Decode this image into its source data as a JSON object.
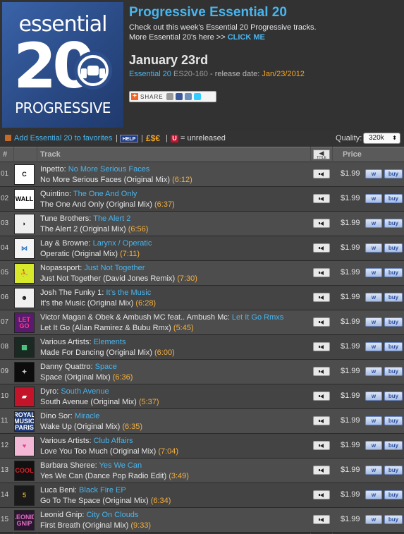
{
  "colors": {
    "accent_blue": "#49b5ee",
    "duration_orange": "#f5b041",
    "logo_blue": "#2d4f8c",
    "unreleased_red": "#c8102e"
  },
  "logo": {
    "top": "essential",
    "middle": "20",
    "bottom": "PROGRESSIVE"
  },
  "header": {
    "title": "Progressive Essential 20",
    "desc1": "Check out this week's Essential 20 Progressive tracks.",
    "desc2_prefix": "More Essential 20's here >>",
    "desc2_link": "CLICK ME",
    "date": "January 23rd",
    "label": "Essential 20",
    "catalog": "ES20-160",
    "release_prefix": " - release date: ",
    "release_date": "Jan/23/2012",
    "share_label": "SHARE"
  },
  "toolbar": {
    "favorites": "Add Essential 20 to favorites",
    "sep": "|",
    "help": "HELP",
    "currency": "£$€",
    "unreleased_badge": "U",
    "unreleased_text": "= unreleased",
    "quality_label": "Quality:",
    "quality_value": "320k"
  },
  "table": {
    "col_num": "#",
    "col_track": "Track",
    "col_title_icon": "TITLE",
    "col_price": "Price",
    "w_label": "w",
    "buy_label": "buy",
    "rows": [
      {
        "num": "01",
        "artist": "Inpetto:",
        "title": "No More Serious Faces",
        "mix": "No More Serious Faces (Original Mix)",
        "dur": "(6:12)",
        "price": "$1.99",
        "art": "C",
        "art_bg": "#ffffff",
        "art_fg": "#111111"
      },
      {
        "num": "02",
        "artist": "Quintino:",
        "title": "The One And Only",
        "mix": "The One And Only (Original Mix)",
        "dur": "(6:37)",
        "price": "$1.99",
        "art": "WALL",
        "art_bg": "#ffffff",
        "art_fg": "#000000"
      },
      {
        "num": "03",
        "artist": "Tune Brothers:",
        "title": "The Alert 2",
        "mix": "The Alert 2 (Original Mix)",
        "dur": "(6:56)",
        "price": "$1.99",
        "art": "◗",
        "art_bg": "#eeeeee",
        "art_fg": "#111111"
      },
      {
        "num": "04",
        "artist": "Lay & Browne:",
        "title": "Larynx / Operatic",
        "mix": "Operatic (Original Mix)",
        "dur": "(7:11)",
        "price": "$1.99",
        "art": "⋈",
        "art_bg": "#f4f4f4",
        "art_fg": "#2a73c4"
      },
      {
        "num": "05",
        "artist": "Nopassport:",
        "title": "Just Not Together",
        "mix": "Just Not Together (David Jones Remix)",
        "dur": "(7:30)",
        "price": "$1.99",
        "art": "⛹",
        "art_bg": "#d8e82a",
        "art_fg": "#222222"
      },
      {
        "num": "06",
        "artist": "Josh The Funky 1:",
        "title": "It's the Music",
        "mix": "It's the Music (Original Mix)",
        "dur": "(6:28)",
        "price": "$1.99",
        "art": "☻",
        "art_bg": "#f0f0f0",
        "art_fg": "#111111"
      },
      {
        "num": "07",
        "artist": "Victor Magan & Obek & Ambush MC feat.. Ambush Mc:",
        "title": "Let It Go Rmxs",
        "mix": "Let It Go (Allan Ramirez & Bubu Rmx)",
        "dur": "(5:45)",
        "price": "$1.99",
        "art": "LET GO",
        "art_bg": "#5a1a6e",
        "art_fg": "#ff3a8a"
      },
      {
        "num": "08",
        "artist": "Various Artists:",
        "title": "Elements",
        "mix": "Made For Dancing (Original Mix)",
        "dur": "(6:00)",
        "price": "$1.99",
        "art": "▦",
        "art_bg": "#1a2a22",
        "art_fg": "#4fd08a"
      },
      {
        "num": "09",
        "artist": "Danny Quattro:",
        "title": "Space",
        "mix": "Space (Original Mix)",
        "dur": "(6:36)",
        "price": "$1.99",
        "art": "✦",
        "art_bg": "#0c0c0c",
        "art_fg": "#cccccc"
      },
      {
        "num": "10",
        "artist": "Dyro:",
        "title": "South Avenue",
        "mix": "South Avenue (Original Mix)",
        "dur": "(5:37)",
        "price": "$1.99",
        "art": "▰",
        "art_bg": "#c4142a",
        "art_fg": "#ffffff"
      },
      {
        "num": "11",
        "artist": "Dino Sor:",
        "title": "Miracle",
        "mix": "Wake Up (Original Mix)",
        "dur": "(6:35)",
        "price": "$1.99",
        "art": "ROYAL MUSIC PARIS",
        "art_bg": "#1e3a7a",
        "art_fg": "#ffffff"
      },
      {
        "num": "12",
        "artist": "Various Artists:",
        "title": "Club Affairs",
        "mix": "Love You Too Much (Original Mix)",
        "dur": "(7:04)",
        "price": "$1.99",
        "art": "♥",
        "art_bg": "#f3b8d6",
        "art_fg": "#e0448a"
      },
      {
        "num": "13",
        "artist": "Barbara Sheree:",
        "title": "Yes We Can",
        "mix": "Yes We Can (Dance Pop Radio Edit)",
        "dur": "(3:49)",
        "price": "$1.99",
        "art": "COOL",
        "art_bg": "#111111",
        "art_fg": "#e0202a"
      },
      {
        "num": "14",
        "artist": "Luca Beni:",
        "title": "Black Fire EP",
        "mix": "Go To The Space (Original Mix)",
        "dur": "(6:34)",
        "price": "$1.99",
        "art": "5",
        "art_bg": "#1a1a1a",
        "art_fg": "#d8a830"
      },
      {
        "num": "15",
        "artist": "Leonid Gnip:",
        "title": "City On Clouds",
        "mix": "First Breath (Original Mix)",
        "dur": "(9:33)",
        "price": "$1.99",
        "art": "LEONID GNIP",
        "art_bg": "#2a1630",
        "art_fg": "#e070c0"
      }
    ]
  }
}
